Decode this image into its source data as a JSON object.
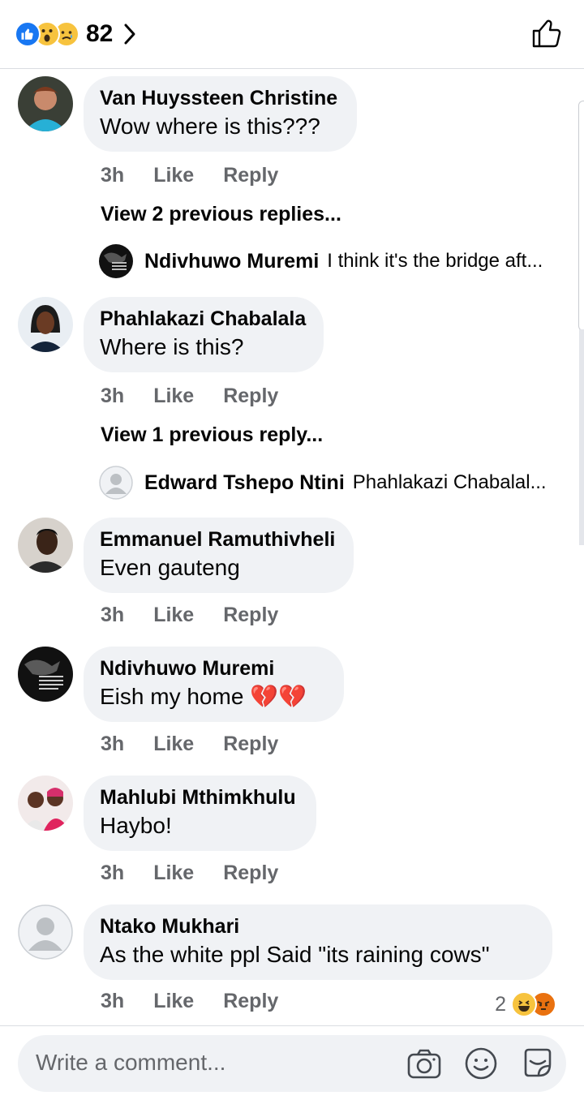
{
  "header": {
    "reaction_icons": [
      "like-icon",
      "wow-icon",
      "sad-icon"
    ],
    "reaction_count": "82"
  },
  "comments": [
    {
      "author": "Van Huyssteen Christine",
      "text": "Wow where is this???",
      "time": "3h",
      "like": "Like",
      "reply": "Reply",
      "view_previous": "View 2 previous replies...",
      "latest_reply": {
        "author": "Ndivhuwo Muremi",
        "text": "I think it's the bridge aft..."
      }
    },
    {
      "author": "Phahlakazi Chabalala",
      "text": "Where is this?",
      "time": "3h",
      "like": "Like",
      "reply": "Reply",
      "view_previous": "View 1 previous reply...",
      "latest_reply": {
        "author": "Edward Tshepo Ntini",
        "text": "Phahlakazi Chabalal..."
      }
    },
    {
      "author": "Emmanuel Ramuthivheli",
      "text": "Even gauteng",
      "time": "3h",
      "like": "Like",
      "reply": "Reply"
    },
    {
      "author": "Ndivhuwo Muremi",
      "text": "Eish my home",
      "emoji": "💔💔",
      "time": "3h",
      "like": "Like",
      "reply": "Reply"
    },
    {
      "author": "Mahlubi Mthimkhulu",
      "text": "Haybo!",
      "time": "3h",
      "like": "Like",
      "reply": "Reply"
    },
    {
      "author": "Ntako Mukhari",
      "text": "As the white ppl Said \"its raining cows\"",
      "time": "3h",
      "like": "Like",
      "reply": "Reply",
      "reaction_count": "2",
      "reaction_icons": [
        "haha-icon",
        "angry-icon"
      ]
    }
  ],
  "composer": {
    "placeholder": "Write a comment..."
  },
  "colors": {
    "accent": "#1877f2",
    "bubble": "#f0f2f5",
    "secondary_text": "#65676b"
  }
}
